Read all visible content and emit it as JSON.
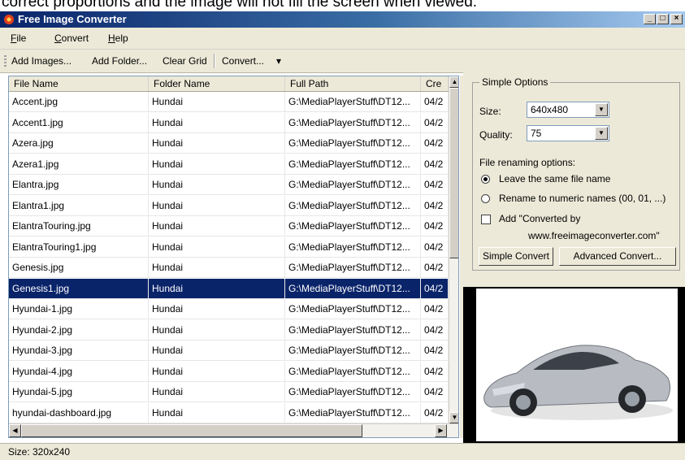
{
  "caption": "correct proportions and the image will not fill the screen when viewed.",
  "window": {
    "title": "Free Image Converter",
    "minimize": "_",
    "maximize": "□",
    "close": "×"
  },
  "menu": [
    {
      "accel": "F",
      "rest": "ile"
    },
    {
      "accel": "C",
      "rest": "onvert"
    },
    {
      "accel": "H",
      "rest": "elp"
    }
  ],
  "toolbar": {
    "add_images": "Add Images...",
    "add_folder": "Add Folder...",
    "clear_grid": "Clear Grid",
    "convert": "Convert...",
    "dropdown_arrow": "▾"
  },
  "grid": {
    "columns": [
      "File Name",
      "Folder Name",
      "Full Path",
      "Cre"
    ],
    "rows": [
      [
        "Accent.jpg",
        "Hundai",
        "G:\\MediaPlayerStuff\\DT12...",
        "04/2"
      ],
      [
        "Accent1.jpg",
        "Hundai",
        "G:\\MediaPlayerStuff\\DT12...",
        "04/2"
      ],
      [
        "Azera.jpg",
        "Hundai",
        "G:\\MediaPlayerStuff\\DT12...",
        "04/2"
      ],
      [
        "Azera1.jpg",
        "Hundai",
        "G:\\MediaPlayerStuff\\DT12...",
        "04/2"
      ],
      [
        "Elantra.jpg",
        "Hundai",
        "G:\\MediaPlayerStuff\\DT12...",
        "04/2"
      ],
      [
        "Elantra1.jpg",
        "Hundai",
        "G:\\MediaPlayerStuff\\DT12...",
        "04/2"
      ],
      [
        "ElantraTouring.jpg",
        "Hundai",
        "G:\\MediaPlayerStuff\\DT12...",
        "04/2"
      ],
      [
        "ElantraTouring1.jpg",
        "Hundai",
        "G:\\MediaPlayerStuff\\DT12...",
        "04/2"
      ],
      [
        "Genesis.jpg",
        "Hundai",
        "G:\\MediaPlayerStuff\\DT12...",
        "04/2"
      ],
      [
        "Genesis1.jpg",
        "Hundai",
        "G:\\MediaPlayerStuff\\DT12...",
        "04/2"
      ],
      [
        "Hyundai-1.jpg",
        "Hundai",
        "G:\\MediaPlayerStuff\\DT12...",
        "04/2"
      ],
      [
        "Hyundai-2.jpg",
        "Hundai",
        "G:\\MediaPlayerStuff\\DT12...",
        "04/2"
      ],
      [
        "Hyundai-3.jpg",
        "Hundai",
        "G:\\MediaPlayerStuff\\DT12...",
        "04/2"
      ],
      [
        "Hyundai-4.jpg",
        "Hundai",
        "G:\\MediaPlayerStuff\\DT12...",
        "04/2"
      ],
      [
        "Hyundai-5.jpg",
        "Hundai",
        "G:\\MediaPlayerStuff\\DT12...",
        "04/2"
      ],
      [
        "hyundai-dashboard.jpg",
        "Hundai",
        "G:\\MediaPlayerStuff\\DT12...",
        "04/2"
      ]
    ],
    "selected_index": 9
  },
  "options": {
    "group_title": "Simple Options",
    "size_label": "Size:",
    "size_value": "640x480",
    "quality_label": "Quality:",
    "quality_value": "75",
    "renaming_label": "File renaming options:",
    "radio_same": "Leave the same file name",
    "radio_numeric": "Rename to numeric names (00, 01, ...)",
    "radio_selected": "same",
    "add_converted_line1": "Add \"Converted by",
    "add_converted_line2": "www.freeimageconverter.com\"",
    "add_converted_checked": false,
    "simple_convert": "Simple Convert",
    "advanced_convert": "Advanced Convert..."
  },
  "preview": {
    "icon": "car-image-icon"
  },
  "status": {
    "text": "Size: 320x240"
  },
  "colors": {
    "selection": "#0a246a",
    "titlebar": "#0a246a",
    "chrome": "#ece9d8"
  }
}
